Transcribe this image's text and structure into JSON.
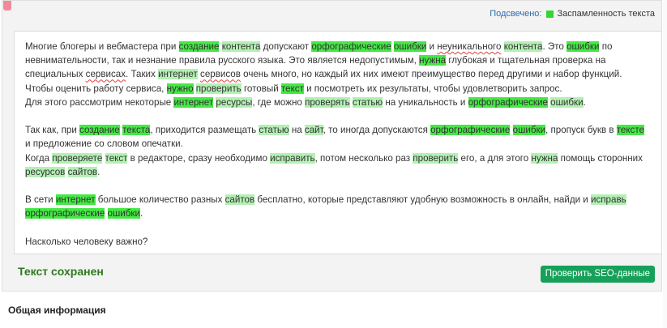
{
  "legend": {
    "label": "Подсвечено:",
    "item": "Заспамленность текста",
    "color": "#33d633"
  },
  "text_paragraphs": [
    [
      {
        "t": "Многие блогеры и вебмастера при "
      },
      {
        "t": "создание",
        "h": 1
      },
      {
        "t": " "
      },
      {
        "t": "контента",
        "h": 2
      },
      {
        "t": " допускают "
      },
      {
        "t": "орфографические",
        "h": 1
      },
      {
        "t": " "
      },
      {
        "t": "ошибки",
        "h": 1
      },
      {
        "t": " и "
      },
      {
        "t": "неуникального",
        "s": 1
      },
      {
        "t": " "
      },
      {
        "t": "контента",
        "h": 2
      },
      {
        "t": ". Это "
      },
      {
        "t": "ошибки",
        "h": 1
      },
      {
        "t": " по невнимательности, так и незнание правила русского языка. Это является недопустимым, "
      },
      {
        "t": "нужна",
        "h": 1
      },
      {
        "t": " глубокая и тщательная проверка на специальных "
      },
      {
        "t": "сервисах",
        "s": 1
      },
      {
        "t": ". Таких "
      },
      {
        "t": "интернет",
        "h": 2
      },
      {
        "t": " "
      },
      {
        "t": "сервисов",
        "s": 1
      },
      {
        "t": " очень много, но каждый их них имеют преимущество перед другими и набор функций."
      },
      {
        "br": 1
      },
      {
        "t": "Чтобы оценить работу сервиса, "
      },
      {
        "t": "нужно",
        "h": 1
      },
      {
        "t": " "
      },
      {
        "t": "проверить",
        "h": 2
      },
      {
        "t": " готовый "
      },
      {
        "t": "текст",
        "h": 1
      },
      {
        "t": " и посмотреть их результаты, чтобы удовлетворить запрос."
      },
      {
        "br": 1
      },
      {
        "t": "Для этого рассмотрим некоторые "
      },
      {
        "t": "интернет",
        "h": 1
      },
      {
        "t": " "
      },
      {
        "t": "ресурсы",
        "h": 2
      },
      {
        "t": ", где можно "
      },
      {
        "t": "проверять",
        "h": 2
      },
      {
        "t": " "
      },
      {
        "t": "статью",
        "h": 2
      },
      {
        "t": " на уникальность и "
      },
      {
        "t": "орфографические",
        "h": 1
      },
      {
        "t": " "
      },
      {
        "t": "ошибки",
        "h": 2
      },
      {
        "t": "."
      }
    ],
    [
      {
        "t": "Так как, при "
      },
      {
        "t": "создание",
        "h": 1
      },
      {
        "t": " "
      },
      {
        "t": "текста",
        "h": 1
      },
      {
        "t": ", приходится размещать "
      },
      {
        "t": "статью",
        "h": 2
      },
      {
        "t": " на "
      },
      {
        "t": "сайт",
        "h": 2
      },
      {
        "t": ", то иногда допускаются "
      },
      {
        "t": "орфографические",
        "h": 1
      },
      {
        "t": " "
      },
      {
        "t": "ошибки",
        "h": 1
      },
      {
        "t": ", пропуск букв в "
      },
      {
        "t": "тексте",
        "h": 1
      },
      {
        "t": " и предложение со словом опечатки."
      },
      {
        "br": 1
      },
      {
        "t": "Когда "
      },
      {
        "t": "проверяете",
        "h": 2
      },
      {
        "t": " "
      },
      {
        "t": "текст",
        "h": 2
      },
      {
        "t": " в редакторе, сразу необходимо "
      },
      {
        "t": "исправить",
        "h": 2
      },
      {
        "t": ", потом несколько раз "
      },
      {
        "t": "проверить",
        "h": 2
      },
      {
        "t": " его, а для этого "
      },
      {
        "t": "нужна",
        "h": 2
      },
      {
        "t": " помощь сторонних "
      },
      {
        "t": "ресурсов",
        "h": 2
      },
      {
        "t": " "
      },
      {
        "t": "сайтов",
        "h": 2
      },
      {
        "t": "."
      }
    ],
    [
      {
        "t": "В сети "
      },
      {
        "t": "интернет",
        "h": 1
      },
      {
        "t": " большое количество разных "
      },
      {
        "t": "сайтов",
        "h": 2
      },
      {
        "t": " бесплатно, которые представляют удобную возможность в онлайн, найди и "
      },
      {
        "t": "исправь",
        "h": 2
      },
      {
        "t": " "
      },
      {
        "t": "орфографические",
        "h": 1
      },
      {
        "t": " "
      },
      {
        "t": "ошибки",
        "h": 1
      },
      {
        "t": "."
      }
    ],
    [
      {
        "t": "Насколько человеку важно?"
      }
    ]
  ],
  "status": {
    "saved": "Текст сохранен"
  },
  "actions": {
    "seo_button": "Проверить SEO-данные"
  },
  "section": {
    "general_title": "Общая информация"
  }
}
